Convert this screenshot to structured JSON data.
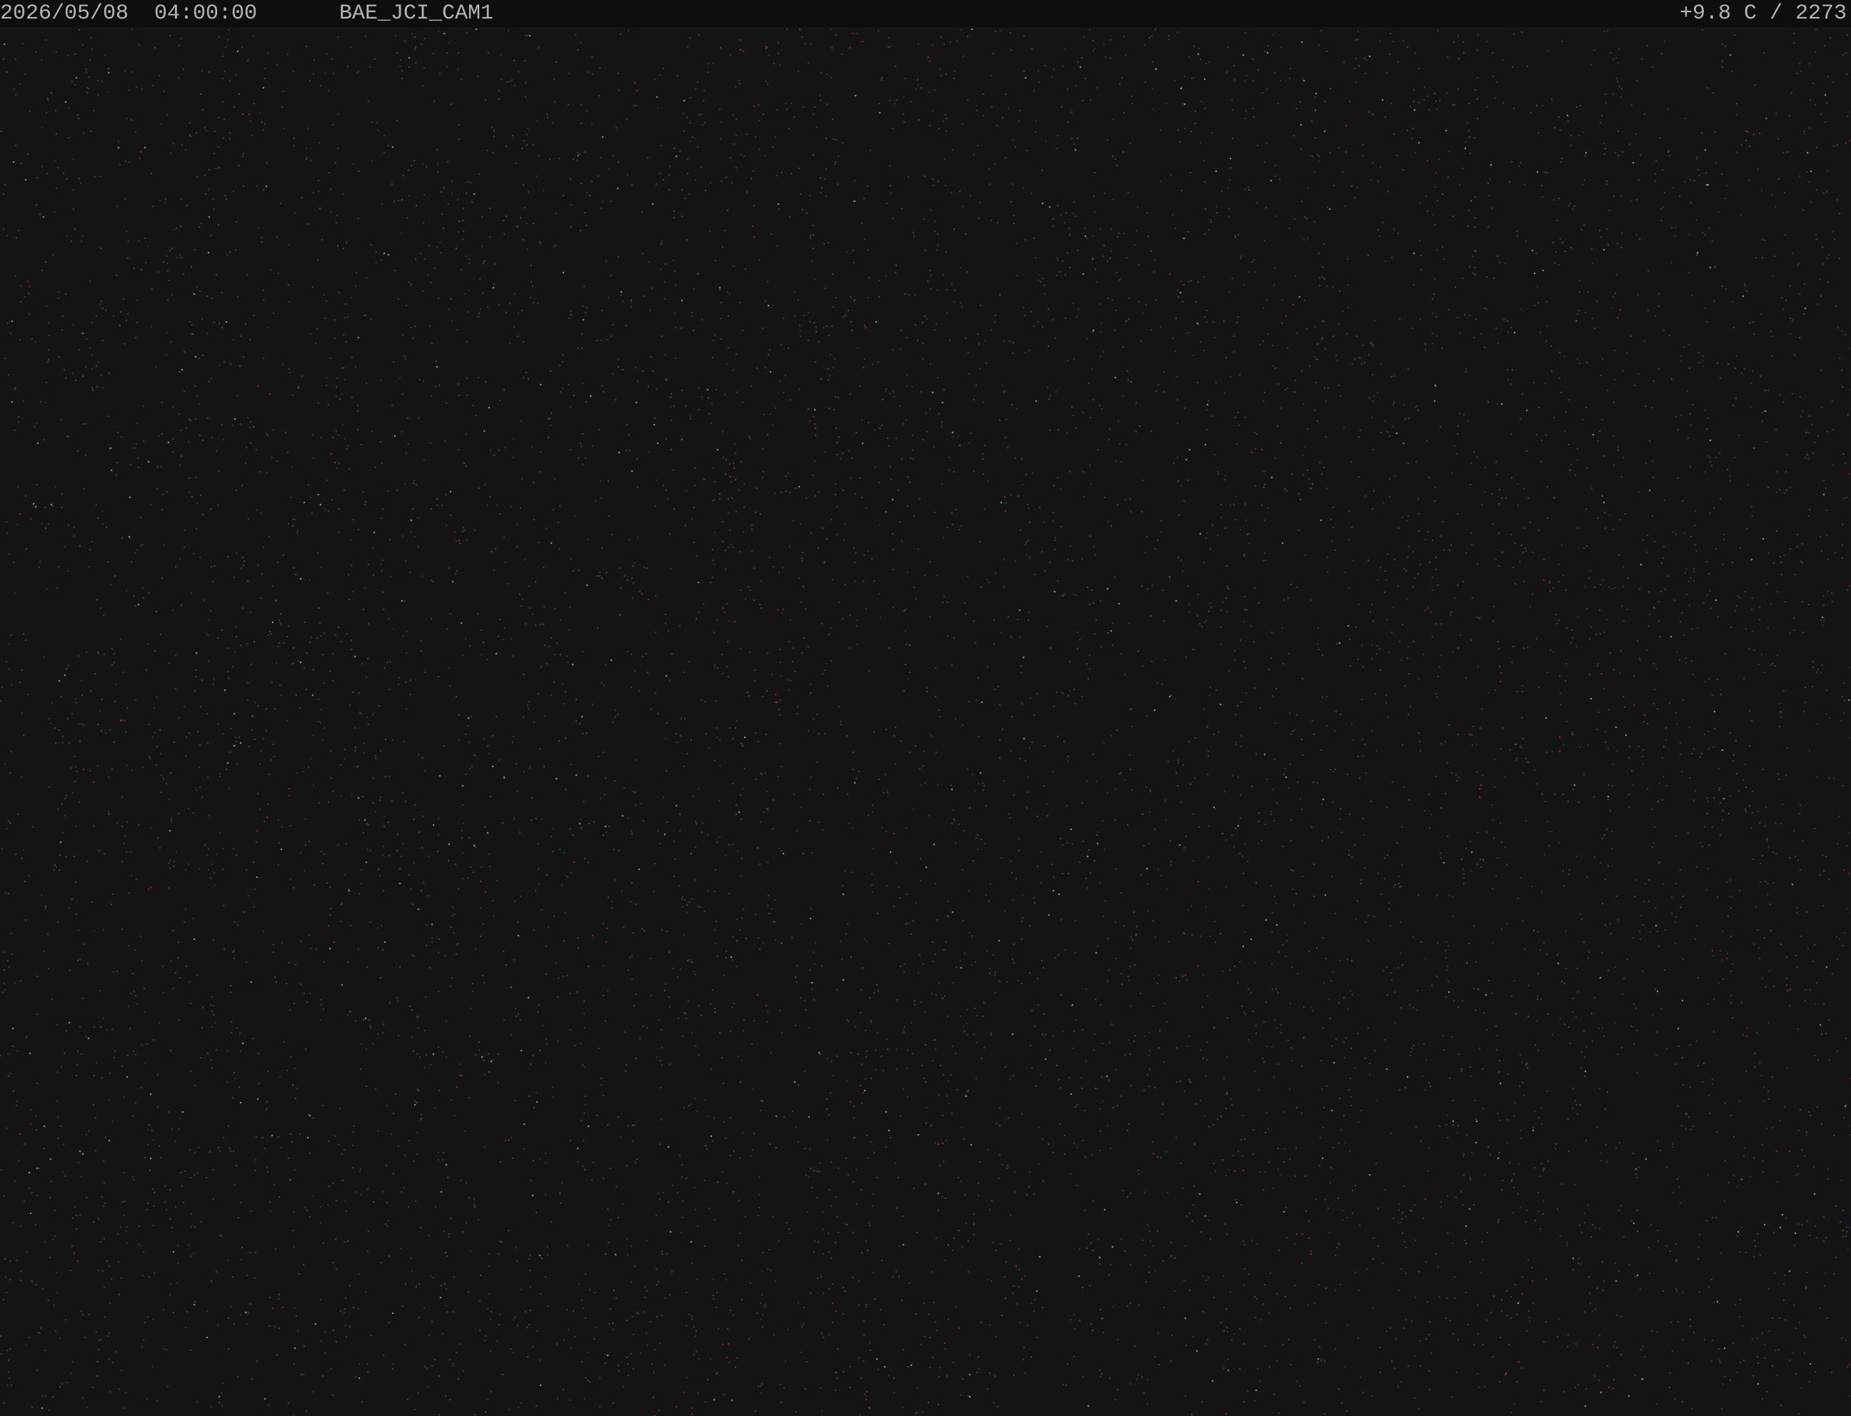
{
  "overlay": {
    "timestamp": "2026/05/08  04:00:00",
    "camera_id": "BAE_JCI_CAM1",
    "readout": "+9.8 C / 2273"
  },
  "colors": {
    "background": "#141414",
    "overlay_bar": "#0e0e0e",
    "overlay_text": "#b4b4b4"
  }
}
